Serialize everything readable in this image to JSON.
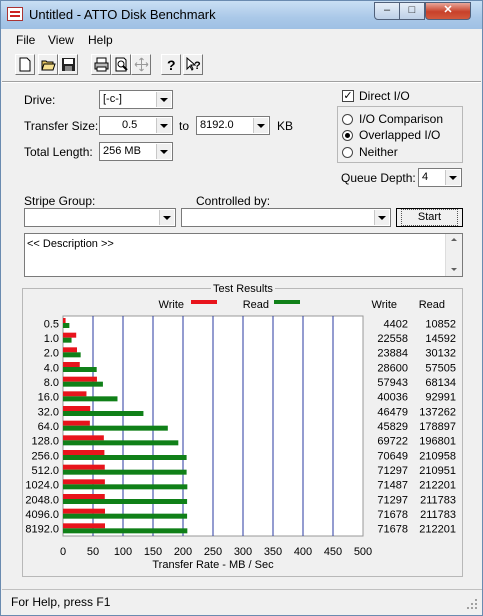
{
  "window": {
    "title": "Untitled - ATTO Disk Benchmark",
    "min": "–",
    "max": "□",
    "close": "✕"
  },
  "menu": [
    "File",
    "View",
    "Help"
  ],
  "toolbar": [
    "new-icon",
    "open-icon",
    "save-icon",
    "print-icon",
    "print-preview-icon",
    "move-icon",
    "help-icon",
    "context-help-icon"
  ],
  "settings": {
    "drive_label": "Drive:",
    "drive_value": "[-c-]",
    "transfer_size_label": "Transfer Size:",
    "transfer_from": "0.5",
    "to_label": "to",
    "transfer_to": "8192.0",
    "kb_label": "KB",
    "total_length_label": "Total Length:",
    "total_length_value": "256 MB",
    "direct_io_label": "Direct I/O",
    "direct_io_checked": true,
    "io_comparison_label": "I/O Comparison",
    "overlapped_io_label": "Overlapped I/O",
    "neither_label": "Neither",
    "selected_mode": "Overlapped I/O",
    "queue_depth_label": "Queue Depth:",
    "queue_depth_value": "4",
    "stripe_group_label": "Stripe Group:",
    "stripe_group_value": "",
    "controlled_by_label": "Controlled by:",
    "controlled_by_value": "",
    "start_label": "Start",
    "description": "<< Description >>"
  },
  "results": {
    "title": "Test Results",
    "write_label": "Write",
    "read_label": "Read",
    "write_col": "Write",
    "read_col": "Read"
  },
  "chart_data": {
    "type": "bar",
    "orientation": "horizontal",
    "xlabel": "Transfer Rate - MB / Sec",
    "xlim": [
      0,
      500
    ],
    "xticks": [
      "0",
      "50",
      "100",
      "150",
      "200",
      "250",
      "300",
      "350",
      "400",
      "450",
      "500"
    ],
    "categories": [
      "0.5",
      "1.0",
      "2.0",
      "4.0",
      "8.0",
      "16.0",
      "32.0",
      "64.0",
      "128.0",
      "256.0",
      "512.0",
      "1024.0",
      "2048.0",
      "4096.0",
      "8192.0"
    ],
    "series": [
      {
        "name": "Write",
        "color": "#e8141c",
        "values": [
          4402,
          22558,
          23884,
          28600,
          57943,
          40036,
          46479,
          45829,
          69722,
          70649,
          71297,
          71487,
          71297,
          71678,
          71678
        ]
      },
      {
        "name": "Read",
        "color": "#108018",
        "values": [
          10852,
          14592,
          30132,
          57505,
          68134,
          92991,
          137262,
          178897,
          196801,
          210958,
          210951,
          212201,
          211783,
          211783,
          212201
        ]
      }
    ],
    "units_note": "values in KB/sec as printed; bars scaled on MB/sec axis",
    "grid": true
  },
  "status": {
    "text": "For Help, press F1"
  }
}
